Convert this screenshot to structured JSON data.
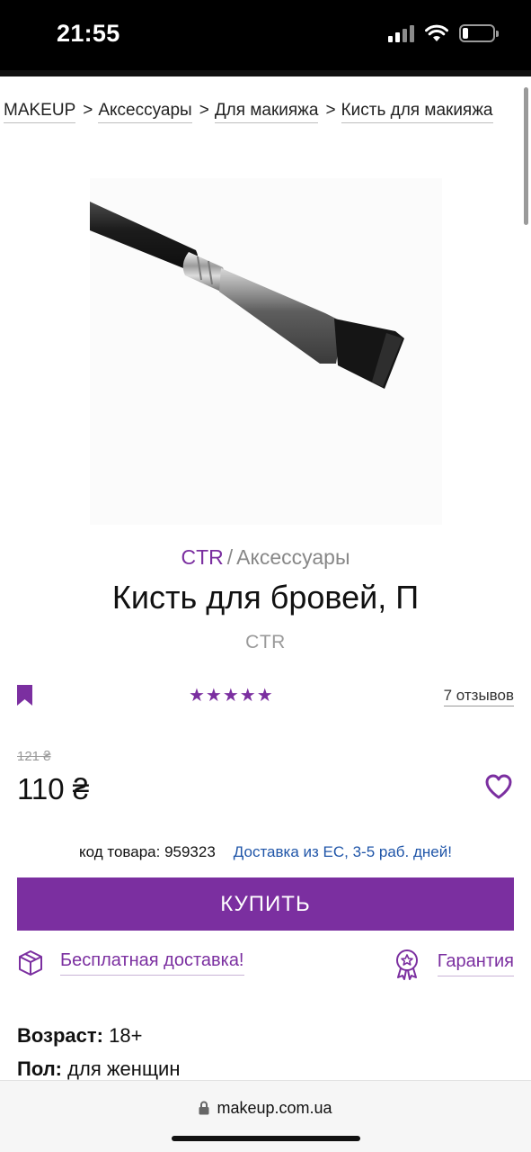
{
  "status_bar": {
    "time": "21:55"
  },
  "breadcrumb": [
    "MAKEUP",
    "Аксессуары",
    "Для макияжа",
    "Кисть для макияжа"
  ],
  "breadcrumb_separator": ">",
  "product": {
    "brand_link": "CTR",
    "brand_separator": "/",
    "category": "Аксессуары",
    "title": "Кисть для бровей, П",
    "brand": "CTR",
    "rating_stars": "★★★★★",
    "rating_value": 5,
    "reviews": "7 отзывов",
    "old_price": "121 ₴",
    "price": "110 ₴",
    "sku": "код товара: 959323",
    "delivery_note": "Доставка из ЕС, 3-5 раб. дней!",
    "buy_label": "КУПИТЬ",
    "free_delivery": "Бесплатная доставка!",
    "guarantee": "Гарантия",
    "age_label": "Возраст:",
    "age_value": "18+",
    "gender_label": "Пол:",
    "gender_value": "для женщин"
  },
  "browser": {
    "url": "makeup.com.ua"
  },
  "colors": {
    "accent": "#7b2fa0",
    "link_blue": "#1f55a8",
    "muted": "#9a9a9a"
  },
  "icons": [
    "signal-icon",
    "wifi-icon",
    "battery-icon",
    "bookmark-icon",
    "heart-icon",
    "delivery-box-icon",
    "guarantee-badge-icon",
    "lock-icon"
  ]
}
